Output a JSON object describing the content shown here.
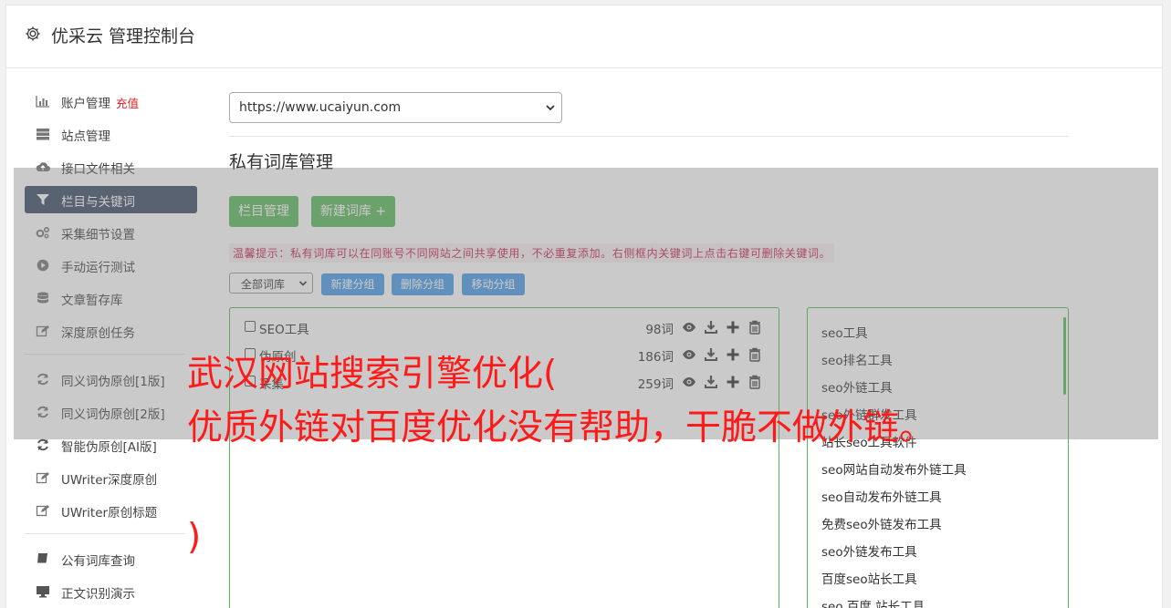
{
  "header": {
    "title": "优采云 管理控制台",
    "icon": "gear-icon"
  },
  "sidebar": {
    "items": [
      {
        "label": "账户管理",
        "badge": "充值",
        "icon": "bar-chart-icon"
      },
      {
        "label": "站点管理",
        "icon": "server-icon"
      },
      {
        "label": "接口文件相关",
        "icon": "cloud-upload-icon"
      },
      {
        "label": "栏目与关键词",
        "icon": "filter-icon",
        "active": true
      },
      {
        "label": "采集细节设置",
        "icon": "cogs-icon"
      },
      {
        "label": "手动运行测试",
        "icon": "play-circle-icon"
      },
      {
        "label": "文章暂存库",
        "icon": "database-icon"
      },
      {
        "label": "深度原创任务",
        "icon": "edit-icon"
      }
    ],
    "items2": [
      {
        "label": "同义词伪原创[1版]",
        "icon": "refresh-icon"
      },
      {
        "label": "同义词伪原创[2版]",
        "icon": "refresh-icon"
      },
      {
        "label": "智能伪原创[AI版]",
        "icon": "refresh-icon"
      },
      {
        "label": "UWriter深度原创",
        "icon": "edit-icon"
      },
      {
        "label": "UWriter原创标题",
        "icon": "edit-icon"
      }
    ],
    "items3": [
      {
        "label": "公有词库查询",
        "icon": "book-icon"
      },
      {
        "label": "正文识别演示",
        "icon": "monitor-icon"
      }
    ]
  },
  "main": {
    "site_select": "https://www.ucaiyun.com",
    "section_title": "私有词库管理",
    "btn_columns": "栏目管理",
    "btn_new_lib": "新建词库 +",
    "tip": "温馨提示：私有词库可以在同账号不同网站之间共享使用，不必重复添加。右侧框内关键词上点击右键可删除关键词。",
    "group_filter": "全部词库",
    "btn_new_group": "新建分组",
    "btn_del_group": "删除分组",
    "btn_move_group": "移动分组",
    "libraries": [
      {
        "name": "SEO工具",
        "count": "98词"
      },
      {
        "name": "伪原创",
        "count": "186词"
      },
      {
        "name": "采集",
        "count": "259词"
      }
    ],
    "keywords": [
      "seo工具",
      "seo排名工具",
      "seo外链工具",
      "seo外链群发工具",
      "站长seo工具软件",
      "seo网站自动发布外链工具",
      "seo自动发布外链工具",
      "免费seo外链发布工具",
      "seo外链发布工具",
      "百度seo站长工具",
      "seo 百度 站长工具"
    ]
  },
  "overlay": {
    "line1": "武汉网站搜索引擎优化(",
    "line2": "优质外链对百度优化没有帮助，干脆不做外链。",
    "line3": ")"
  },
  "colors": {
    "active_nav": "#3c4c66",
    "green": "#5cb85c",
    "blue": "#4a9ce8",
    "red": "#ff1a1a"
  }
}
